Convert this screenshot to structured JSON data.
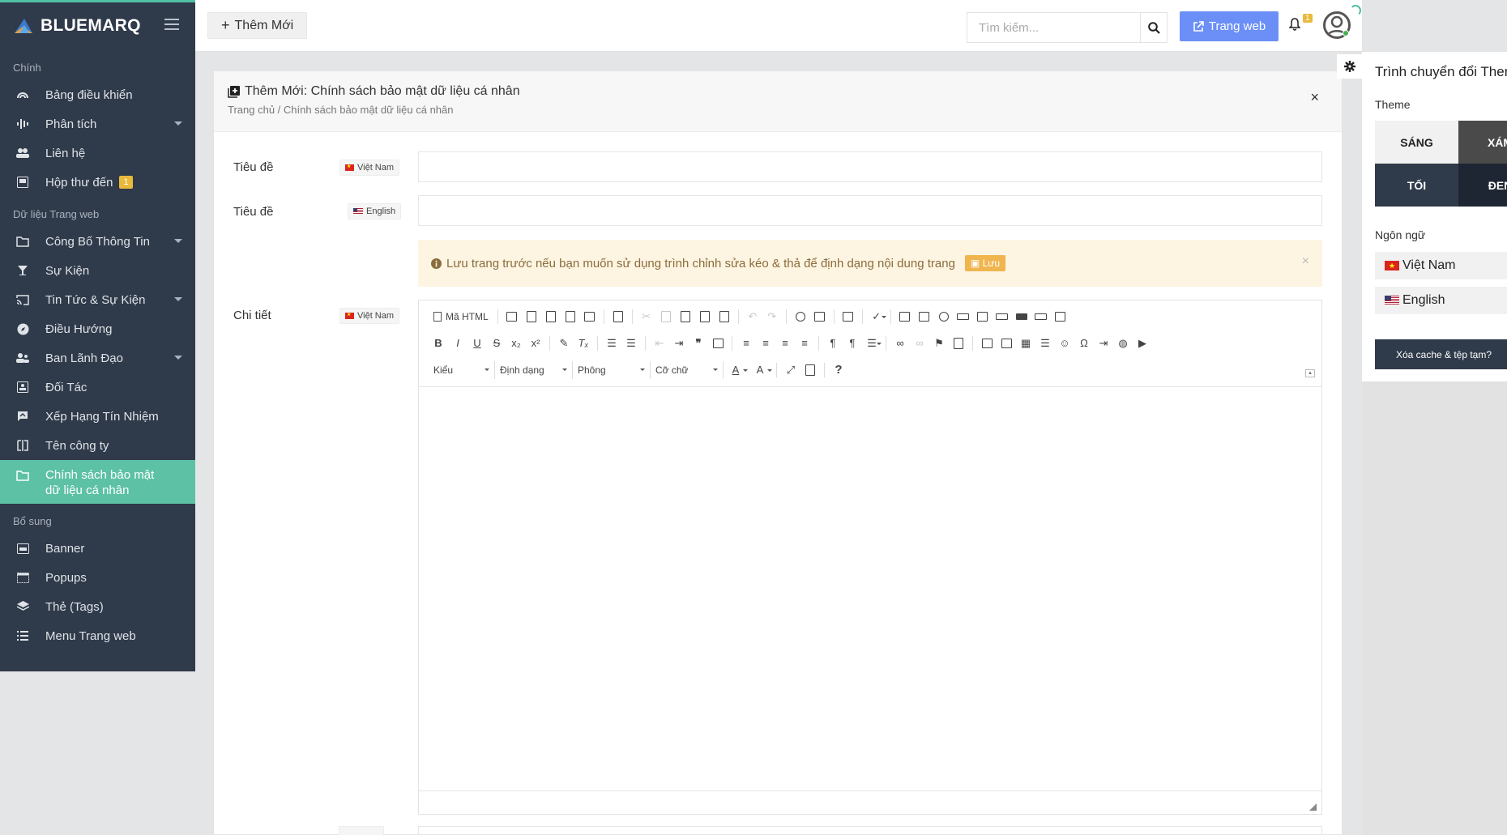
{
  "brand": {
    "name": "BLUEMARQ"
  },
  "sidebar": {
    "sections": [
      {
        "title": "Chính"
      },
      {
        "title": "Dữ liệu Trang web"
      },
      {
        "title": "Bổ sung"
      }
    ],
    "main_items": [
      {
        "label": "Bảng điều khiển",
        "icon": "dashboard-icon"
      },
      {
        "label": "Phân tích",
        "icon": "analytics-icon",
        "has_submenu": true
      },
      {
        "label": "Liên hệ",
        "icon": "contacts-icon"
      },
      {
        "label": "Hộp thư đến",
        "icon": "inbox-icon",
        "badge": "1"
      }
    ],
    "web_items": [
      {
        "label": "Công Bố Thông Tin",
        "icon": "folder-icon",
        "has_submenu": true
      },
      {
        "label": "Sự Kiện",
        "icon": "trophy-icon"
      },
      {
        "label": "Tin Tức & Sự Kiện",
        "icon": "cast-icon",
        "has_submenu": true
      },
      {
        "label": "Điều Hướng",
        "icon": "compass-icon"
      },
      {
        "label": "Ban Lãnh Đạo",
        "icon": "team-icon",
        "has_submenu": true
      },
      {
        "label": "Đối Tác",
        "icon": "partner-icon"
      },
      {
        "label": "Xếp Hạng Tín Nhiệm",
        "icon": "rating-icon"
      },
      {
        "label": "Tên công ty",
        "icon": "company-icon"
      },
      {
        "label": "Chính sách bảo mật dữ liệu cá nhân",
        "icon": "folder-icon",
        "active": true
      }
    ],
    "extra_items": [
      {
        "label": "Banner",
        "icon": "banner-icon"
      },
      {
        "label": "Popups",
        "icon": "popup-icon"
      },
      {
        "label": "Thẻ (Tags)",
        "icon": "tags-icon"
      },
      {
        "label": "Menu Trang web",
        "icon": "menu-list-icon"
      }
    ]
  },
  "header": {
    "add_label": "Thêm Mới",
    "search_placeholder": "Tìm kiếm...",
    "website_label": "Trang web",
    "notification_count": "1"
  },
  "card": {
    "title": "Thêm Mới: Chính sách bảo mật dữ liệu cá nhân",
    "breadcrumb": "Trang chủ / Chính sách bảo mật dữ liệu cá nhân",
    "close_symbol": "×"
  },
  "form": {
    "title_label_1": "Tiêu đề",
    "title_label_2": "Tiêu đề",
    "detail_label": "Chi tiết",
    "lang_vn": "Việt Nam",
    "lang_en": "English",
    "title_vn_value": "",
    "title_en_value": "",
    "alert_text": "Lưu trang trước nếu bạn muốn sử dụng trình chỉnh sửa kéo & thả để định dạng nội dung trang",
    "alert_save_label": "Lưu",
    "alert_close": "×"
  },
  "editor": {
    "source_label": "Mã HTML",
    "combo_style": "Kiểu",
    "combo_format": "Định dạng",
    "combo_font": "Phông",
    "combo_size": "Cỡ chữ",
    "help_symbol": "?"
  },
  "settings_panel": {
    "title": "Trình chuyển đổi Theme",
    "theme_label": "Theme",
    "themes": [
      "SÁNG",
      "XÁM",
      "TỐI",
      "ĐEN"
    ],
    "language_label": "Ngôn ngữ",
    "languages": [
      "Việt Nam",
      "English"
    ],
    "clear_label": "Xóa cache & tệp tạm?",
    "colors": {
      "light_bg": "#f1f1f1",
      "gray_bg": "#4a4a4a",
      "dark_bg": "#2f3a4a",
      "black_bg": "#1f2633"
    }
  },
  "colors": {
    "sidebar_bg": "#2f3a4a",
    "active_bg": "#5cc1a5",
    "primary_btn": "#6b8ff7",
    "badge": "#e8b93b",
    "alert_bg": "#fdf4e2"
  }
}
